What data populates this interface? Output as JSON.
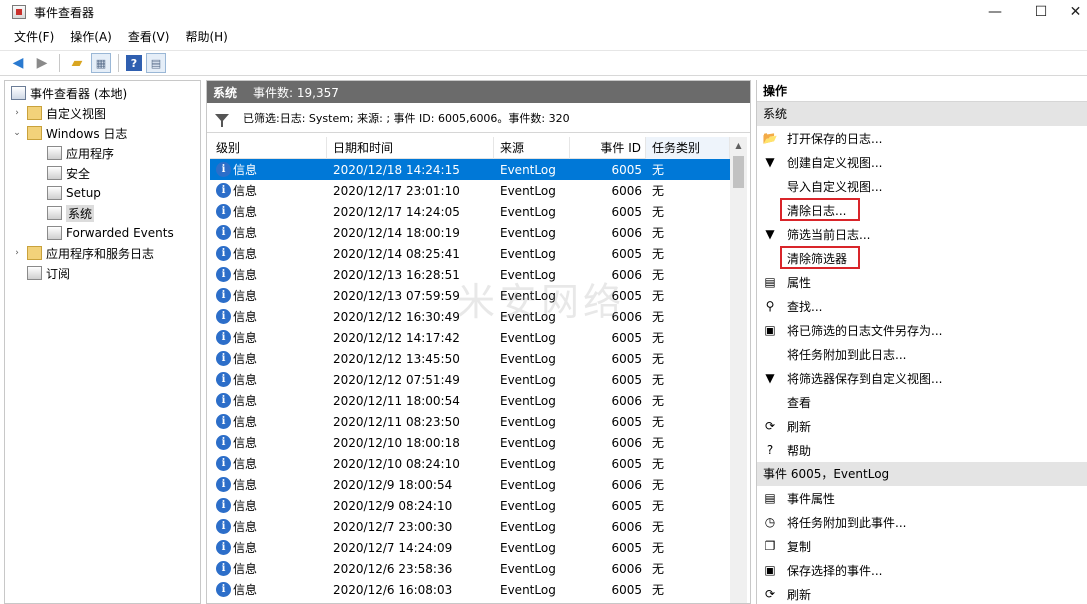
{
  "window": {
    "title": "事件查看器",
    "controls": {
      "minimize": "—",
      "maximize": "☐",
      "close": "✕"
    }
  },
  "menu": [
    "文件(F)",
    "操作(A)",
    "查看(V)",
    "帮助(H)"
  ],
  "tree": {
    "root": "事件查看器 (本地)",
    "items": [
      {
        "label": "自定义视图",
        "expander": "›",
        "depth": 1
      },
      {
        "label": "Windows 日志",
        "expander": "⌄",
        "depth": 1
      },
      {
        "label": "应用程序",
        "expander": "",
        "depth": 2
      },
      {
        "label": "安全",
        "expander": "",
        "depth": 2
      },
      {
        "label": "Setup",
        "expander": "",
        "depth": 2
      },
      {
        "label": "系统",
        "expander": "",
        "depth": 2
      },
      {
        "label": "Forwarded Events",
        "expander": "",
        "depth": 2
      },
      {
        "label": "应用程序和服务日志",
        "expander": "›",
        "depth": 1
      },
      {
        "label": "订阅",
        "expander": "",
        "depth": 1
      }
    ]
  },
  "center": {
    "title": "系统",
    "count": "事件数: 19,357",
    "filter": "已筛选:日志: System; 来源: ; 事件 ID: 6005,6006。事件数: 320",
    "columns": [
      "级别",
      "日期和时间",
      "来源",
      "事件 ID",
      "任务类别"
    ],
    "rows": [
      {
        "level": "信息",
        "date": "2020/12/18 14:24:15",
        "source": "EventLog",
        "id": "6005",
        "cat": "无"
      },
      {
        "level": "信息",
        "date": "2020/12/17 23:01:10",
        "source": "EventLog",
        "id": "6006",
        "cat": "无"
      },
      {
        "level": "信息",
        "date": "2020/12/17 14:24:05",
        "source": "EventLog",
        "id": "6005",
        "cat": "无"
      },
      {
        "level": "信息",
        "date": "2020/12/14 18:00:19",
        "source": "EventLog",
        "id": "6006",
        "cat": "无"
      },
      {
        "level": "信息",
        "date": "2020/12/14 08:25:41",
        "source": "EventLog",
        "id": "6005",
        "cat": "无"
      },
      {
        "level": "信息",
        "date": "2020/12/13 16:28:51",
        "source": "EventLog",
        "id": "6006",
        "cat": "无"
      },
      {
        "level": "信息",
        "date": "2020/12/13 07:59:59",
        "source": "EventLog",
        "id": "6005",
        "cat": "无"
      },
      {
        "level": "信息",
        "date": "2020/12/12 16:30:49",
        "source": "EventLog",
        "id": "6006",
        "cat": "无"
      },
      {
        "level": "信息",
        "date": "2020/12/12 14:17:42",
        "source": "EventLog",
        "id": "6005",
        "cat": "无"
      },
      {
        "level": "信息",
        "date": "2020/12/12 13:45:50",
        "source": "EventLog",
        "id": "6005",
        "cat": "无"
      },
      {
        "level": "信息",
        "date": "2020/12/12 07:51:49",
        "source": "EventLog",
        "id": "6005",
        "cat": "无"
      },
      {
        "level": "信息",
        "date": "2020/12/11 18:00:54",
        "source": "EventLog",
        "id": "6006",
        "cat": "无"
      },
      {
        "level": "信息",
        "date": "2020/12/11 08:23:50",
        "source": "EventLog",
        "id": "6005",
        "cat": "无"
      },
      {
        "level": "信息",
        "date": "2020/12/10 18:00:18",
        "source": "EventLog",
        "id": "6006",
        "cat": "无"
      },
      {
        "level": "信息",
        "date": "2020/12/10 08:24:10",
        "source": "EventLog",
        "id": "6005",
        "cat": "无"
      },
      {
        "level": "信息",
        "date": "2020/12/9 18:00:54",
        "source": "EventLog",
        "id": "6006",
        "cat": "无"
      },
      {
        "level": "信息",
        "date": "2020/12/9 08:24:10",
        "source": "EventLog",
        "id": "6005",
        "cat": "无"
      },
      {
        "level": "信息",
        "date": "2020/12/7 23:00:30",
        "source": "EventLog",
        "id": "6006",
        "cat": "无"
      },
      {
        "level": "信息",
        "date": "2020/12/7 14:24:09",
        "source": "EventLog",
        "id": "6005",
        "cat": "无"
      },
      {
        "level": "信息",
        "date": "2020/12/6 23:58:36",
        "source": "EventLog",
        "id": "6006",
        "cat": "无"
      },
      {
        "level": "信息",
        "date": "2020/12/6 16:08:03",
        "source": "EventLog",
        "id": "6005",
        "cat": "无"
      }
    ],
    "watermark": "米安网络"
  },
  "actions": {
    "title": "操作",
    "section1": "系统",
    "items1": [
      {
        "label": "打开保存的日志...",
        "icon": "folder-open-icon",
        "glyph": "📂"
      },
      {
        "label": "创建自定义视图...",
        "icon": "filter-create-icon",
        "glyph": "▼"
      },
      {
        "label": "导入自定义视图...",
        "icon": "",
        "glyph": ""
      },
      {
        "label": "清除日志...",
        "icon": "",
        "glyph": "",
        "highlight": true
      },
      {
        "label": "筛选当前日志...",
        "icon": "filter-icon",
        "glyph": "▼"
      },
      {
        "label": "清除筛选器",
        "icon": "",
        "glyph": "",
        "highlight": true
      },
      {
        "label": "属性",
        "icon": "properties-icon",
        "glyph": "▤"
      },
      {
        "label": "查找...",
        "icon": "binoculars-icon",
        "glyph": "⚲"
      },
      {
        "label": "将已筛选的日志文件另存为...",
        "icon": "save-icon",
        "glyph": "▣"
      },
      {
        "label": "将任务附加到此日志...",
        "icon": "",
        "glyph": ""
      },
      {
        "label": "将筛选器保存到自定义视图...",
        "icon": "filter-save-icon",
        "glyph": "▼"
      },
      {
        "label": "查看",
        "icon": "",
        "glyph": ""
      },
      {
        "label": "刷新",
        "icon": "refresh-icon",
        "glyph": "⟳"
      },
      {
        "label": "帮助",
        "icon": "help-icon",
        "glyph": "?"
      }
    ],
    "section2": "事件 6005，EventLog",
    "items2": [
      {
        "label": "事件属性",
        "icon": "event-properties-icon",
        "glyph": "▤"
      },
      {
        "label": "将任务附加到此事件...",
        "icon": "task-icon",
        "glyph": "◷"
      },
      {
        "label": "复制",
        "icon": "copy-icon",
        "glyph": "❐"
      },
      {
        "label": "保存选择的事件...",
        "icon": "save-icon",
        "glyph": "▣"
      },
      {
        "label": "刷新",
        "icon": "refresh-icon",
        "glyph": "⟳"
      }
    ]
  }
}
